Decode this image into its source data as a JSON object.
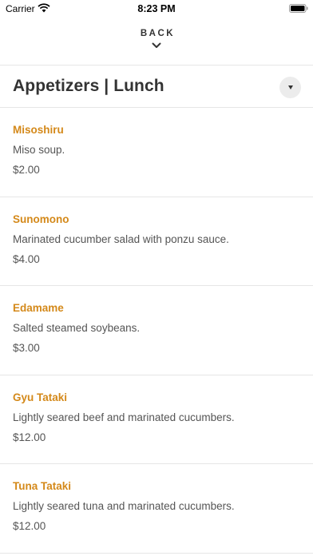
{
  "status_bar": {
    "carrier": "Carrier",
    "time": "8:23 PM"
  },
  "header": {
    "back_label": "BACK"
  },
  "page": {
    "title": "Appetizers | Lunch"
  },
  "menu": {
    "items": [
      {
        "name": "Misoshiru",
        "description": "Miso soup.",
        "price": "$2.00"
      },
      {
        "name": "Sunomono",
        "description": "Marinated cucumber salad with ponzu sauce.",
        "price": "$4.00"
      },
      {
        "name": "Edamame",
        "description": "Salted steamed soybeans.",
        "price": "$3.00"
      },
      {
        "name": "Gyu Tataki",
        "description": "Lightly seared beef and marinated cucumbers.",
        "price": "$12.00"
      },
      {
        "name": "Tuna Tataki",
        "description": "Lightly seared tuna and marinated cucumbers.",
        "price": "$12.00"
      }
    ]
  },
  "colors": {
    "accent": "#d4891a",
    "text": "#333333",
    "divider": "#e6e6e6"
  },
  "icons": {
    "back": "chevron-down-icon",
    "dropdown": "dropdown-caret-icon"
  }
}
